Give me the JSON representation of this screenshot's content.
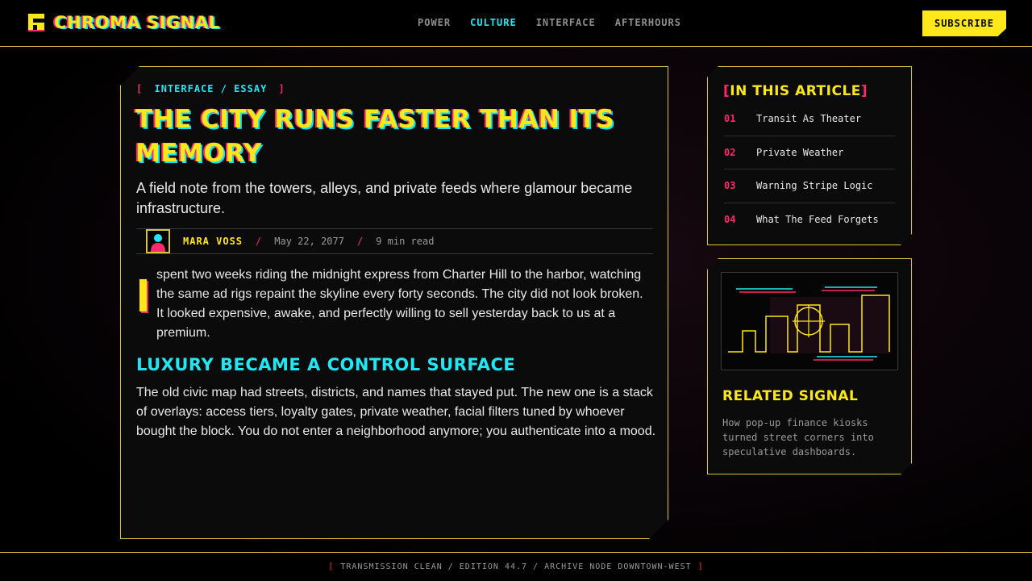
{
  "brand": {
    "name": "CHROMA SIGNAL",
    "colors": {
      "yellow": "#ffe81a",
      "cyan": "#22e6f2",
      "magenta": "#ff2a6d",
      "border": "#d8c43a"
    }
  },
  "nav": {
    "items": [
      {
        "label": "POWER",
        "active": false
      },
      {
        "label": "CULTURE",
        "active": true
      },
      {
        "label": "INTERFACE",
        "active": false
      },
      {
        "label": "AFTERHOURS",
        "active": false
      }
    ],
    "subscribe_label": "SUBSCRIBE"
  },
  "article": {
    "kicker_open": "[",
    "kicker": "INTERFACE / ESSAY",
    "kicker_close": "]",
    "title": "THE CITY RUNS FASTER THAN ITS MEMORY",
    "dek": "A field note from the towers, alleys, and private feeds where glamour became infrastructure.",
    "author": "MARA VOSS",
    "separator": "/",
    "date": "May 22, 2077",
    "read_time": "9 min read",
    "paragraph1": "spent two weeks riding the midnight express from Charter Hill to the harbor, watching the same ad rigs repaint the skyline every forty seconds. The city did not look broken. It looked expensive, awake, and perfectly willing to sell yesterday back to us at a premium.",
    "subhead": "LUXURY BECAME A CONTROL SURFACE",
    "paragraph2": "The old civic map had streets, districts, and names that stayed put. The new one is a stack of overlays: access tiers, loyalty gates, private weather, facial filters tuned by whoever bought the block. You do not enter a neighborhood anymore; you authenticate into a mood."
  },
  "toc": {
    "title_open": "[",
    "title": "IN THIS ARTICLE",
    "title_close": "]",
    "items": [
      {
        "num": "01",
        "label": "Transit As Theater"
      },
      {
        "num": "02",
        "label": "Private Weather"
      },
      {
        "num": "03",
        "label": "Warning Stripe Logic"
      },
      {
        "num": "04",
        "label": "What The Feed Forgets"
      }
    ]
  },
  "related": {
    "title": "RELATED SIGNAL",
    "text": "How pop-up finance kiosks turned street corners into speculative dashboards."
  },
  "footer": {
    "open": "[",
    "text": "TRANSMISSION CLEAN / EDITION 44.7 / ARCHIVE NODE DOWNTOWN-WEST",
    "close": "]"
  }
}
